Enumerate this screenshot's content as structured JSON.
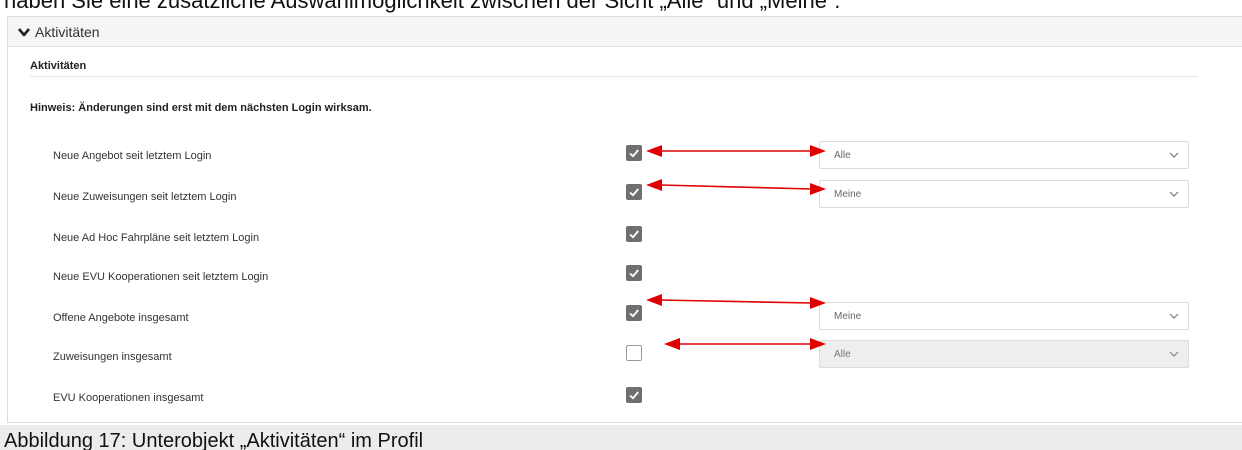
{
  "page": {
    "top_text": "haben Sie eine zusätzliche Auswahlmöglichkeit zwischen der Sicht „Alle“ und „Meine“.",
    "caption": "Abbildung 17: Unterobjekt „Aktivitäten“ im Profil"
  },
  "panel": {
    "header_label": "Aktivitäten",
    "section_title": "Aktivitäten",
    "hint": "Hinweis: Änderungen sind erst mit dem nächsten Login wirksam."
  },
  "rows": [
    {
      "label": "Neue Angebot seit letztem Login",
      "checked": true,
      "select_value": "Alle",
      "select_disabled": false
    },
    {
      "label": "Neue Zuweisungen seit letztem Login",
      "checked": true,
      "select_value": "Meine",
      "select_disabled": false
    },
    {
      "label": "Neue Ad Hoc Fahrpläne seit letztem Login",
      "checked": true
    },
    {
      "label": "Neue EVU Kooperationen seit letztem Login",
      "checked": true
    },
    {
      "label": "Offene Angebote insgesamt",
      "checked": true,
      "select_value": "Meine",
      "select_disabled": false
    },
    {
      "label": "Zuweisungen insgesamt",
      "checked": false,
      "select_value": "Alle",
      "select_disabled": true
    },
    {
      "label": "EVU Kooperationen insgesamt",
      "checked": true
    }
  ],
  "colors": {
    "annotation_arrow": "#e00000",
    "checkbox_checked": "#6f6f6f",
    "header_bg": "#f5f5f5"
  },
  "icons": {
    "header": "chevron-down-icon",
    "checkbox": "checkmark-icon",
    "select": "caret-down-icon",
    "annotation": "double-arrow-icon"
  }
}
